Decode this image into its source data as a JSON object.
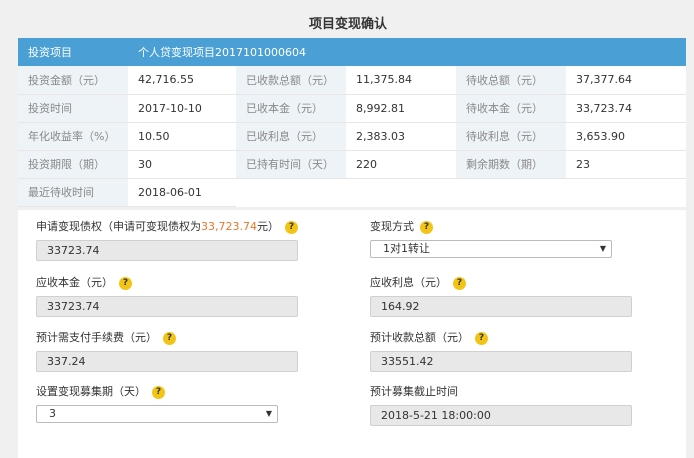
{
  "title": "项目变现确认",
  "header": {
    "label": "投资项目",
    "value": "个人贷变现项目2017101000604"
  },
  "rows": [
    [
      {
        "label": "投资金额（元）",
        "value": "42,716.55"
      },
      {
        "label": "已收款总额（元）",
        "value": "11,375.84"
      },
      {
        "label": "待收总额（元）",
        "value": "37,377.64"
      }
    ],
    [
      {
        "label": "投资时间",
        "value": "2017-10-10"
      },
      {
        "label": "已收本金（元）",
        "value": "8,992.81"
      },
      {
        "label": "待收本金（元）",
        "value": "33,723.74"
      }
    ],
    [
      {
        "label": "年化收益率（%）",
        "value": "10.50"
      },
      {
        "label": "已收利息（元）",
        "value": "2,383.03"
      },
      {
        "label": "待收利息（元）",
        "value": "3,653.90"
      }
    ],
    [
      {
        "label": "投资期限（期）",
        "value": "30"
      },
      {
        "label": "已持有时间（天）",
        "value": "220"
      },
      {
        "label": "剩余期数（期）",
        "value": "23"
      }
    ]
  ],
  "last_row": {
    "label": "最近待收时间",
    "value": "2018-06-01"
  },
  "form": {
    "apply": {
      "label_prefix": "申请变现债权（申请可变现债权为",
      "label_amount": "33,723.74",
      "label_suffix": "元）",
      "value": "33723.74"
    },
    "method": {
      "label": "变现方式",
      "value": "1对1转让"
    },
    "principal": {
      "label": "应收本金（元）",
      "value": "33723.74"
    },
    "interest": {
      "label": "应收利息（元）",
      "value": "164.92"
    },
    "fee": {
      "label": "预计需支付手续费（元）",
      "value": "337.24"
    },
    "total": {
      "label": "预计收款总额（元）",
      "value": "33551.42"
    },
    "period": {
      "label": "设置变现募集期（天）",
      "value": "3"
    },
    "deadline": {
      "label": "预计募集截止时间",
      "value": "2018-5-21 18:00:00"
    },
    "help_glyph": "?"
  },
  "colors": {
    "header_blue": "#4a9fd5",
    "help_yellow": "#f2c514",
    "highlight": "#e8782c"
  }
}
